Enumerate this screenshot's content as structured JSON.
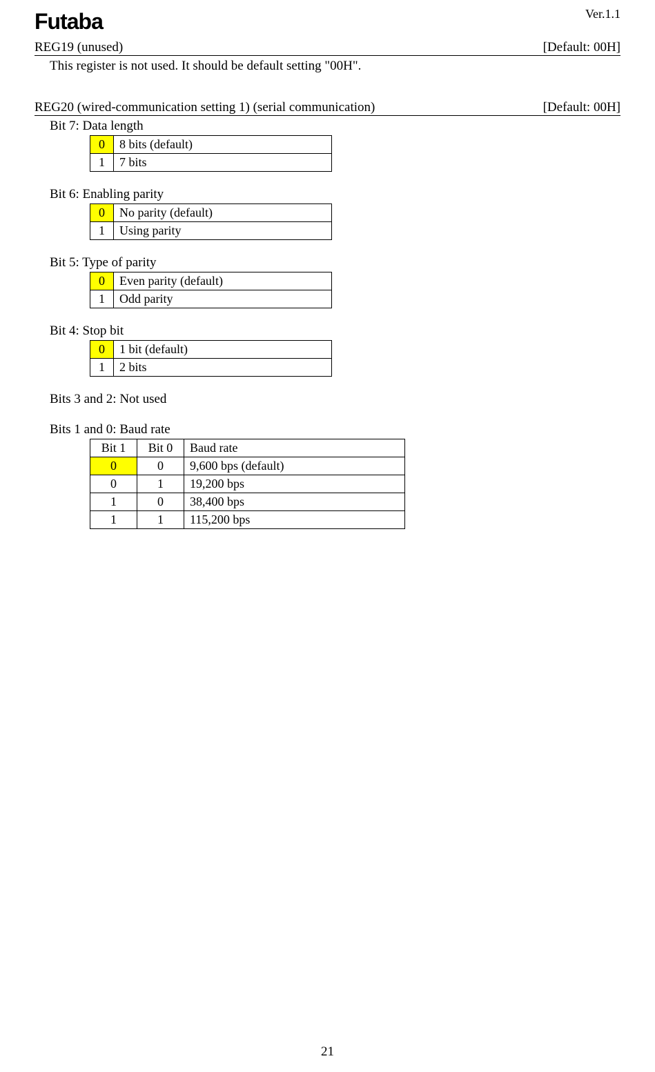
{
  "version": "Ver.1.1",
  "logo": "Futaba",
  "pagenum": "21",
  "reg19": {
    "title": "REG19 (unused)",
    "default": "[Default: 00H]",
    "body": "This register is not used.    It should be default setting \"00H\"."
  },
  "reg20": {
    "title": "REG20 (wired-communication setting 1) (serial communication)",
    "default": "[Default: 00H]",
    "bit7": {
      "title": "Bit 7: Data length",
      "r0v": "0",
      "r0d": "8 bits (default)",
      "r1v": "1",
      "r1d": "7 bits"
    },
    "bit6": {
      "title": "Bit 6: Enabling parity",
      "r0v": "0",
      "r0d": "No parity (default)",
      "r1v": "1",
      "r1d": "Using parity"
    },
    "bit5": {
      "title": "Bit 5: Type of parity",
      "r0v": "0",
      "r0d": "Even parity (default)",
      "r1v": "1",
      "r1d": "Odd parity"
    },
    "bit4": {
      "title": "Bit 4: Stop bit",
      "r0v": "0",
      "r0d": "1 bit (default)",
      "r1v": "1",
      "r1d": "2 bits"
    },
    "bits32": "Bits 3 and 2: Not used",
    "bits10": {
      "title": "Bits 1 and 0: Baud rate",
      "h1": "Bit 1",
      "h0": "Bit 0",
      "hr": "Baud rate",
      "r0b1": "0",
      "r0b0": "0",
      "r0r": "9,600 bps (default)",
      "r1b1": "0",
      "r1b0": "1",
      "r1r": "19,200 bps",
      "r2b1": "1",
      "r2b0": "0",
      "r2r": "38,400 bps",
      "r3b1": "1",
      "r3b0": "1",
      "r3r": "115,200 bps"
    }
  }
}
